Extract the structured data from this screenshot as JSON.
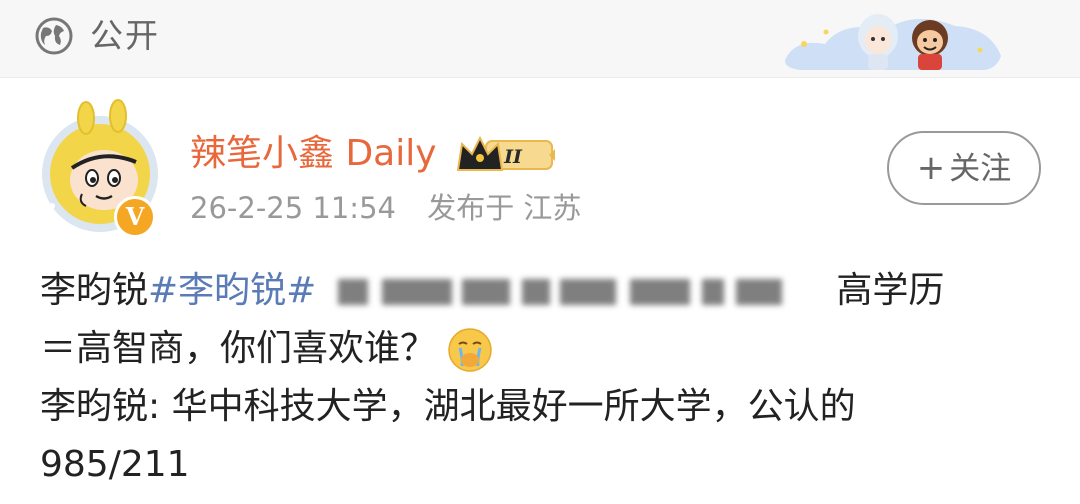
{
  "topbar": {
    "visibility_icon": "globe-icon",
    "visibility_label": "公开",
    "decoration": "anime-characters-sticker"
  },
  "author": {
    "avatar": "cartoon-avatar",
    "verified_badge": "V",
    "name": "辣笔小鑫 Daily",
    "level_badge_icon": "crown-icon",
    "level_badge_text": "II",
    "timestamp": "26-2-25 11:54",
    "location": "发布于 江苏"
  },
  "follow_button": {
    "label": "关注",
    "icon": "plus-icon"
  },
  "post": {
    "line1_start": "李昀锐",
    "hashtag": "#李昀锐#",
    "line1_end": "高学历",
    "line2": "＝高智商，你们喜欢谁？",
    "emoji": "crying-face-emoji",
    "line3": "李昀锐: 华中科技大学，湖北最好一所大学，公认的",
    "line4": "985/211"
  },
  "colors": {
    "name": "#e8683c",
    "hashtag": "#5a7bb5",
    "meta": "#999999",
    "badge": "#f5a623"
  }
}
